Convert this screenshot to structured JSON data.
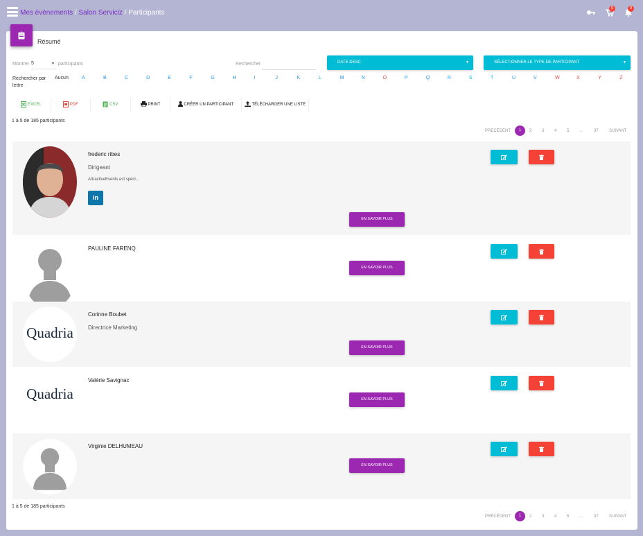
{
  "breadcrumb": {
    "events": "Mes évènements",
    "event": "Salon Serviciz",
    "current": "Participants",
    "sep": "/"
  },
  "top_icons": {
    "cart_badge": "0",
    "bell_badge": "0"
  },
  "card": {
    "title": "Résumé"
  },
  "filters": {
    "show_label": "Montrer",
    "show_value": "5",
    "show_suffix": "participants",
    "search_label": "Rechercher",
    "search_value": "",
    "sort_dropdown": "DATE DESC",
    "type_dropdown": "SÉLECTIONNER LE TYPE DE PARTICIPANT",
    "letter_label": "Rechercher par lettre",
    "none_label": "Aucun",
    "letters": [
      "A",
      "B",
      "C",
      "D",
      "E",
      "F",
      "G",
      "H",
      "I",
      "J",
      "K",
      "L",
      "M",
      "N",
      "O",
      "P",
      "Q",
      "R",
      "S",
      "T",
      "U",
      "V",
      "W",
      "X",
      "Y",
      "Z"
    ]
  },
  "toolbar": {
    "excel": "EXCEL",
    "pdf": "PDF",
    "csv": "CSV",
    "print": "PRINT",
    "create": "CRÉER UN PARTICIPANT",
    "upload": "TÉLÉCHARGER UNE LISTE"
  },
  "summary": "1 à 5 de 185 participants",
  "pagination": {
    "prev": "PRÉCÉDENT",
    "pages": [
      "1",
      "2",
      "3",
      "4",
      "5",
      "...",
      "37"
    ],
    "next": "SUIVANT"
  },
  "participants": [
    {
      "name": "frederic ribes",
      "role": "Dirigeant",
      "desc": "AttractiveEvents est spéci...",
      "linkedin": "in",
      "more": "EN SAVOIR PLUS"
    },
    {
      "name": "PAULINE FARENQ",
      "role": "",
      "desc": "",
      "more": "EN SAVOIR PLUS"
    },
    {
      "name": "Corinne Boubet",
      "role": "Directrice Marketing",
      "desc": "",
      "logo": "Quadria",
      "more": "EN SAVOIR PLUS"
    },
    {
      "name": "Valérie Savignac",
      "role": "",
      "desc": "",
      "logo": "Quadria",
      "more": "EN SAVOIR PLUS"
    },
    {
      "name": "Virginie DELHUMEAU",
      "role": "",
      "desc": "",
      "more": "EN SAVOIR PLUS"
    }
  ],
  "colors": {
    "primary": "#9c27b0",
    "cyan": "#00bcd4",
    "red": "#f44336",
    "bg": "#b3b5d3"
  }
}
